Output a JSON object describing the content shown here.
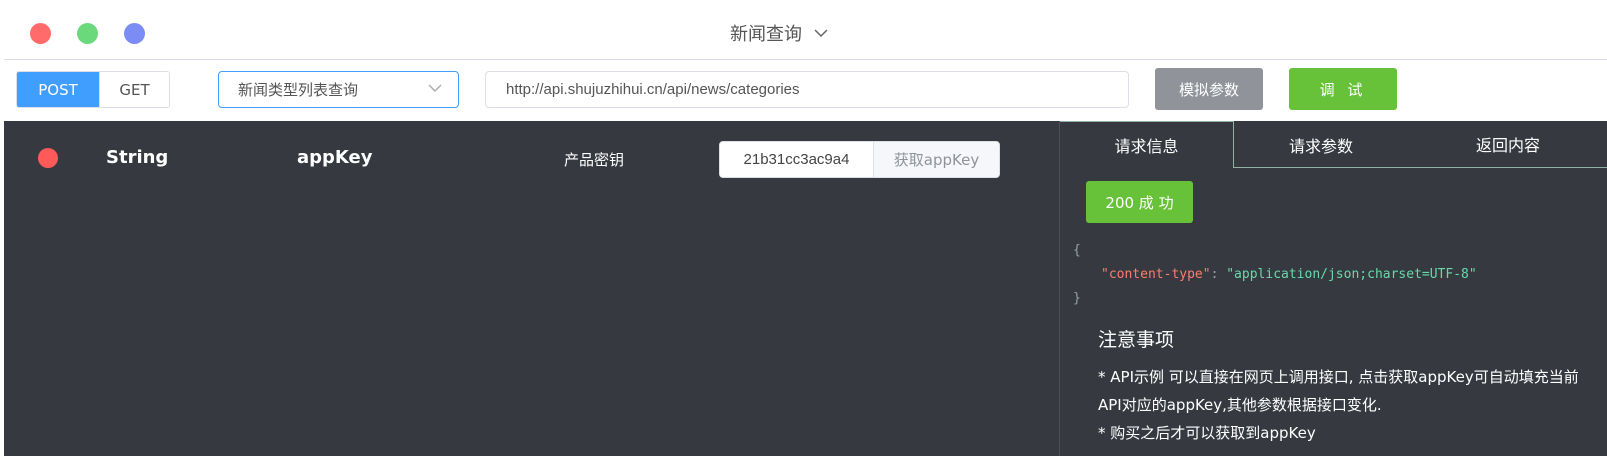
{
  "window": {
    "title": "新闻查询"
  },
  "toolbar": {
    "methods": [
      "POST",
      "GET"
    ],
    "selected_api": "新闻类型列表查询",
    "url": "http://api.shujuzhihui.cn/api/news/categories",
    "mock_label": "模拟参数",
    "debug_label": "调 试"
  },
  "params": [
    {
      "type": "String",
      "name": "appKey",
      "description": "产品密钥",
      "value": "21b31cc3ac9a4",
      "get_key_label": "获取appKey"
    }
  ],
  "info": {
    "tabs": [
      "请求信息",
      "请求参数",
      "返回内容"
    ],
    "status": "200 成 功",
    "code": {
      "open": "{",
      "key": "\"content-type\"",
      "sep": ": ",
      "value": "\"application/json;charset=UTF-8\"",
      "close": "}"
    },
    "notes_title": "注意事项",
    "notes": [
      "* API示例 可以直接在网页上调用接口, 点击获取appKey可自动填充当前API对应的appKey,其他参数根据接口变化.",
      "* 购买之后才可以获取到appKey"
    ]
  },
  "colors": {
    "primary": "#409eff",
    "success": "#67c23a",
    "info": "#909399",
    "panel": "#363a40",
    "danger": "#ff5a5a"
  }
}
